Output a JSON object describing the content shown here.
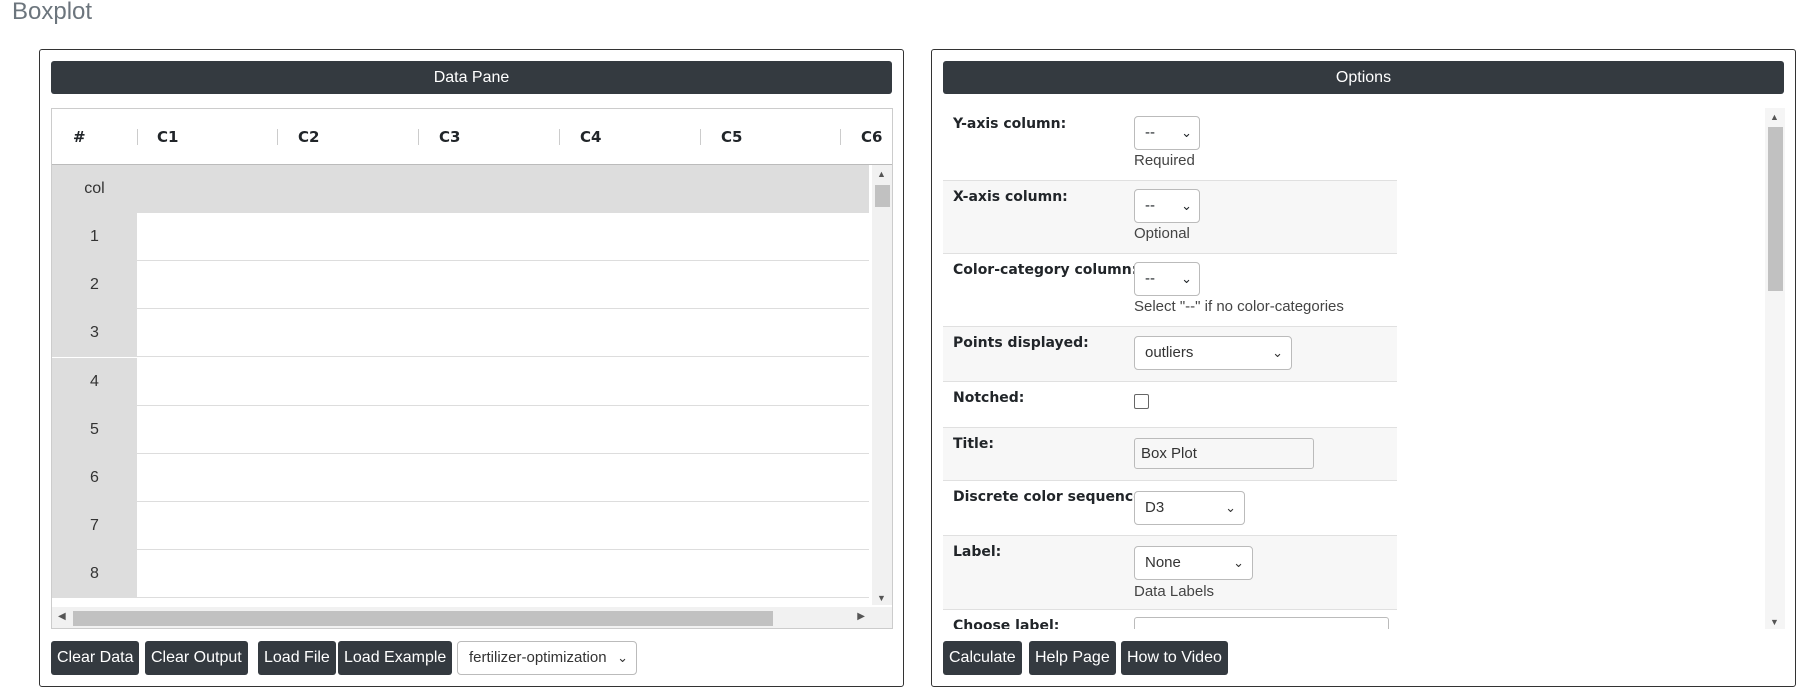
{
  "page": {
    "title": "Boxplot"
  },
  "data_pane": {
    "header": "Data Pane",
    "columns": [
      "#",
      "C1",
      "C2",
      "C3",
      "C4",
      "C5",
      "C6"
    ],
    "first_row_label": "col",
    "row_labels": [
      "1",
      "2",
      "3",
      "4",
      "5",
      "6",
      "7",
      "8"
    ],
    "buttons": {
      "clear_data": "Clear Data",
      "clear_output": "Clear Output",
      "load_file": "Load File",
      "load_example": "Load Example"
    },
    "example_select": "fertilizer-optimization"
  },
  "options": {
    "header": "Options",
    "y_axis": {
      "label": "Y-axis column:",
      "value": "--",
      "help": "Required"
    },
    "x_axis": {
      "label": "X-axis column:",
      "value": "--",
      "help": "Optional"
    },
    "color_category": {
      "label": "Color-category column:",
      "value": "--",
      "help": "Select \"--\" if no color-categories"
    },
    "points": {
      "label": "Points displayed:",
      "value": "outliers"
    },
    "notched": {
      "label": "Notched:",
      "checked": false
    },
    "title": {
      "label": "Title:",
      "value": "Box Plot"
    },
    "color_sequence": {
      "label": "Discrete color sequence:",
      "value": "D3"
    },
    "label": {
      "label": "Label:",
      "value": "None",
      "help": "Data Labels"
    },
    "choose_label": {
      "label": "Choose label:"
    },
    "buttons": {
      "calculate": "Calculate",
      "help_page": "Help Page",
      "how_to_video": "How to Video"
    }
  }
}
